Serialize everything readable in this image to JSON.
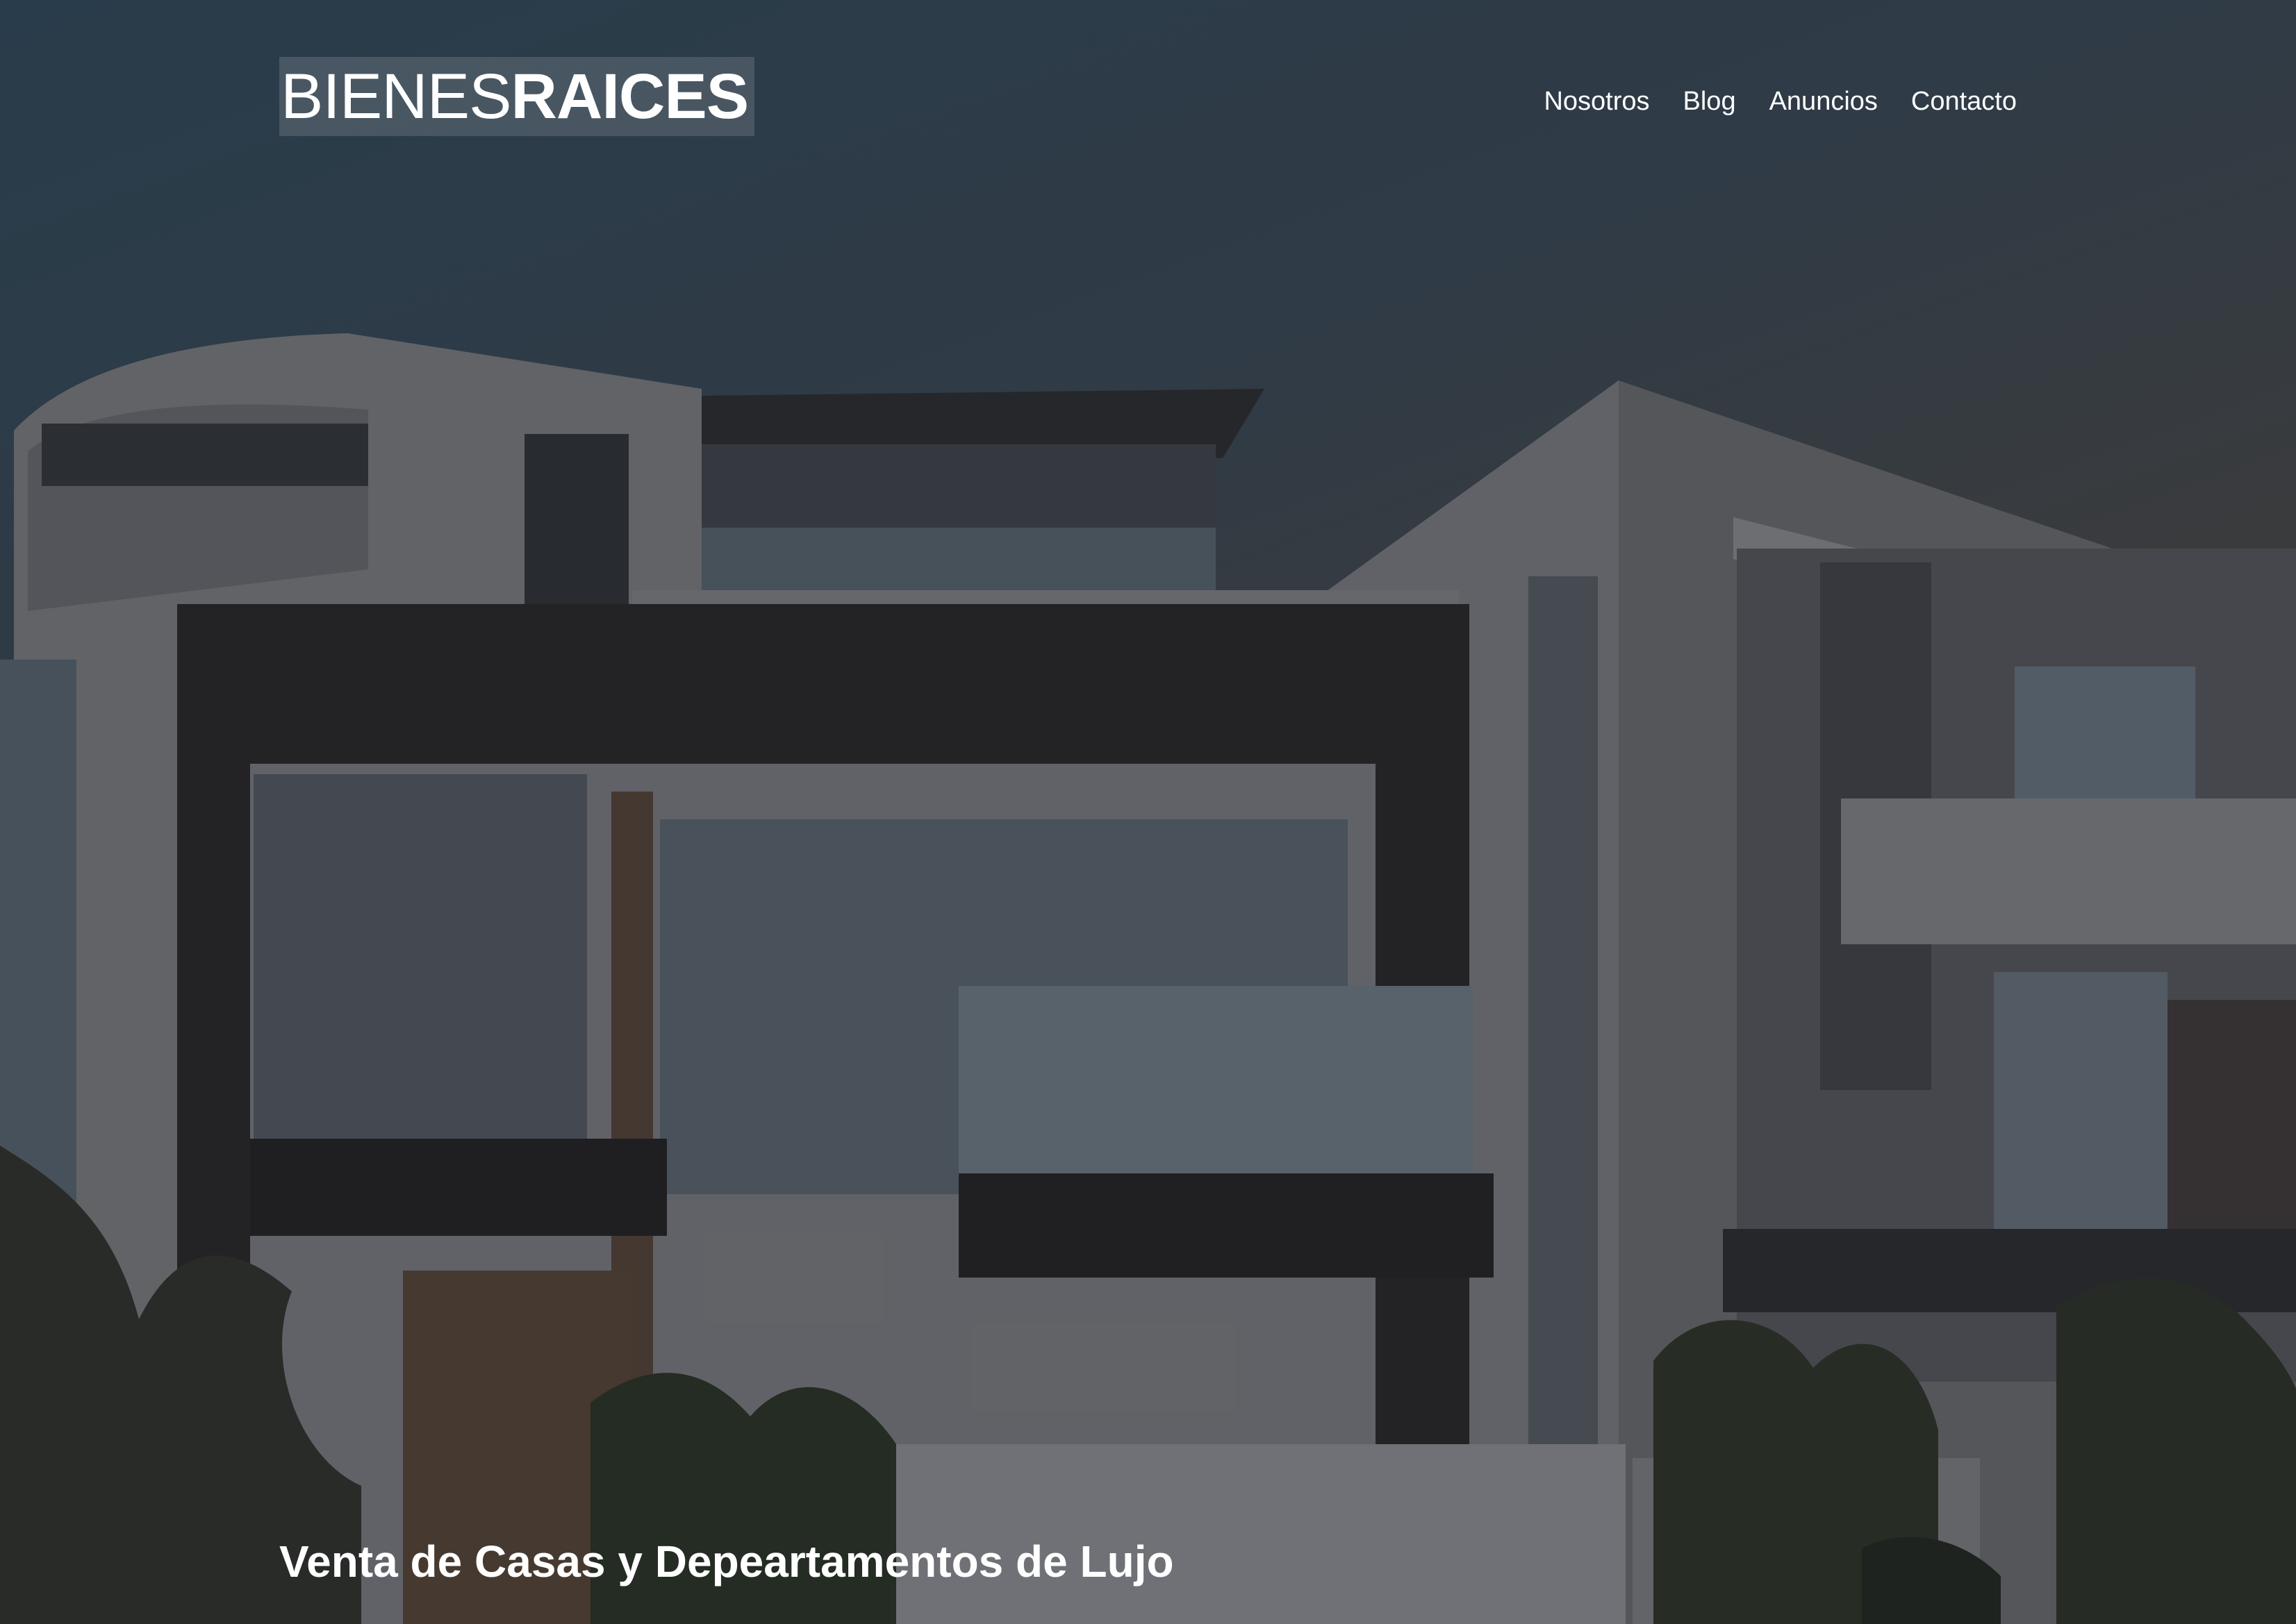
{
  "header": {
    "logo": {
      "light": "BIENES",
      "bold": "RAICES"
    },
    "nav": [
      {
        "label": "Nosotros"
      },
      {
        "label": "Blog"
      },
      {
        "label": "Anuncios"
      },
      {
        "label": "Contacto"
      }
    ]
  },
  "hero": {
    "tagline": "Venta de Casas y Depeartamentos de Lujo"
  },
  "colors": {
    "text": "#ffffff",
    "sky": "#2d4252",
    "overlay": "#3a3d42"
  }
}
